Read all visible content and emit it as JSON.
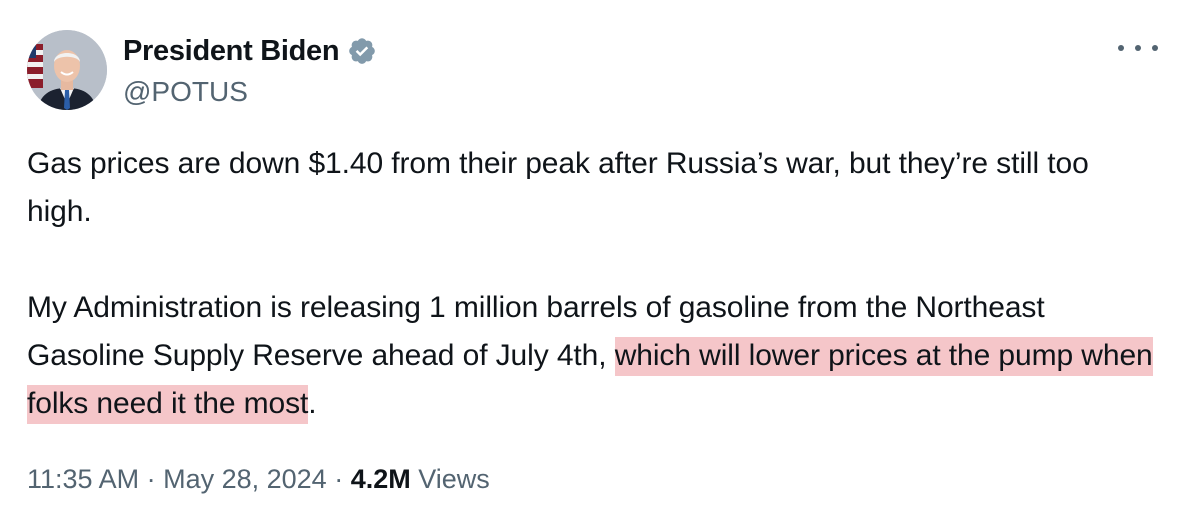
{
  "author": {
    "display_name": "President Biden",
    "handle": "@POTUS",
    "verified": true,
    "avatar_icon": "portrait-avatar"
  },
  "more_icon": "more-horizontal-icon",
  "tweet": {
    "line1": "Gas prices are down $1.40 from their peak after Russia’s war, but they’re still too high.",
    "line2_plain": "My Administration is releasing 1 million barrels of gasoline from the Northeast Gasoline Supply Reserve ahead of July 4th, ",
    "line2_highlight": "which will lower prices at the pump when folks need it the most",
    "line2_end": "."
  },
  "meta": {
    "time": "11:35 AM",
    "sep1": " · ",
    "date": "May 28, 2024",
    "sep2": " · ",
    "views_count": "4.2M",
    "views_label": " Views"
  },
  "colors": {
    "text": "#0f1419",
    "secondary": "#536471",
    "highlight": "#f5c6c9",
    "verified_badge": "#829aab"
  }
}
